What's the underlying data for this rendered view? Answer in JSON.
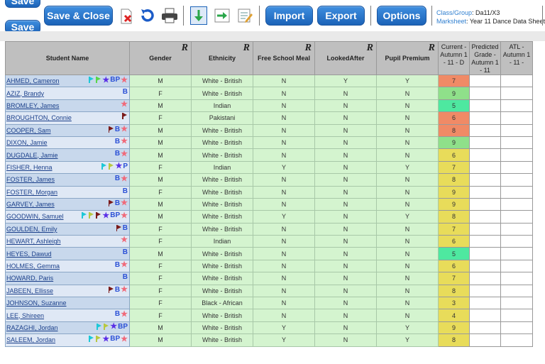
{
  "toolbar": {
    "save_label": "Save",
    "save2_label": "Save",
    "save_close_label": "Save & Close",
    "import_label": "Import",
    "export_label": "Export",
    "options_label": "Options",
    "class_group_key": "Class/Group",
    "class_group_value": ": Da11/X3",
    "marksheet_key": "Marksheet",
    "marksheet_value": ": Year 11 Dance Data Sheet"
  },
  "headers": {
    "student_name": "Student Name",
    "gender": "Gender",
    "ethnicity": "Ethnicity",
    "fsm": "Free School Meal",
    "looked_after": "LookedAfter",
    "pupil_premium": "Pupil Premium",
    "r": "R",
    "current": "Current - Autumn 1 - 11 - D",
    "predicted": "Predicted Grade - Autumn 1 - 11",
    "atl": "ATL - Autumn 1 - 11 -"
  },
  "colors": {
    "red": "#f08a66",
    "green": "#8fe08a",
    "teal": "#4ee8a0",
    "yellow": "#e8dc5a",
    "star_pink": "#f06a7a",
    "star_purple": "#5a2ee6",
    "b_blue": "#2a4fd6",
    "flag_teal": "#1ec8d8",
    "flag_green": "#5ad64a",
    "flag_maroon": "#7a1a1a",
    "flag_olive": "#b8c840"
  },
  "students": [
    {
      "name": "AHMED, Cameron",
      "gender": "M",
      "ethnicity": "White - British",
      "fsm": "N",
      "la": "Y",
      "pp": "Y",
      "current": "7",
      "cc": "red",
      "flags": [
        "flag_teal",
        "flag_green",
        "star_purple",
        "BP",
        "star_pink"
      ]
    },
    {
      "name": "AZIZ, Brandy",
      "gender": "F",
      "ethnicity": "White - British",
      "fsm": "N",
      "la": "N",
      "pp": "N",
      "current": "9",
      "cc": "green",
      "flags": [
        "B"
      ]
    },
    {
      "name": "BROMLEY, James",
      "gender": "M",
      "ethnicity": "Indian",
      "fsm": "N",
      "la": "N",
      "pp": "N",
      "current": "5",
      "cc": "teal",
      "flags": [
        "star_pink"
      ]
    },
    {
      "name": "BROUGHTON, Connie",
      "gender": "F",
      "ethnicity": "Pakistani",
      "fsm": "N",
      "la": "N",
      "pp": "N",
      "current": "6",
      "cc": "red",
      "flags": [
        "flag_maroon"
      ]
    },
    {
      "name": "COOPER, Sam",
      "gender": "M",
      "ethnicity": "White - British",
      "fsm": "N",
      "la": "N",
      "pp": "N",
      "current": "8",
      "cc": "red",
      "flags": [
        "flag_maroon",
        "B",
        "star_pink"
      ]
    },
    {
      "name": "DIXON, Jamie",
      "gender": "M",
      "ethnicity": "White - British",
      "fsm": "N",
      "la": "N",
      "pp": "N",
      "current": "9",
      "cc": "green",
      "flags": [
        "B",
        "star_pink"
      ]
    },
    {
      "name": "DUGDALE, Jamie",
      "gender": "M",
      "ethnicity": "White - British",
      "fsm": "N",
      "la": "N",
      "pp": "N",
      "current": "6",
      "cc": "yellow",
      "flags": [
        "B",
        "star_pink"
      ]
    },
    {
      "name": "FISHER, Henna",
      "gender": "F",
      "ethnicity": "Indian",
      "fsm": "Y",
      "la": "N",
      "pp": "Y",
      "current": "7",
      "cc": "yellow",
      "flags": [
        "flag_teal",
        "flag_olive",
        "star_purple",
        "P"
      ]
    },
    {
      "name": "FOSTER, James",
      "gender": "M",
      "ethnicity": "White - British",
      "fsm": "N",
      "la": "N",
      "pp": "N",
      "current": "8",
      "cc": "yellow",
      "flags": [
        "B",
        "star_pink"
      ]
    },
    {
      "name": "FOSTER, Morgan",
      "gender": "F",
      "ethnicity": "White - British",
      "fsm": "N",
      "la": "N",
      "pp": "N",
      "current": "9",
      "cc": "yellow",
      "flags": [
        "B"
      ]
    },
    {
      "name": "GARVEY, James",
      "gender": "M",
      "ethnicity": "White - British",
      "fsm": "N",
      "la": "N",
      "pp": "N",
      "current": "9",
      "cc": "yellow",
      "flags": [
        "flag_maroon",
        "B",
        "star_pink"
      ]
    },
    {
      "name": "GOODWIN, Samuel",
      "gender": "M",
      "ethnicity": "White - British",
      "fsm": "Y",
      "la": "N",
      "pp": "Y",
      "current": "8",
      "cc": "yellow",
      "flags": [
        "flag_teal",
        "flag_olive",
        "flag_maroon",
        "star_purple",
        "BP",
        "star_pink"
      ]
    },
    {
      "name": "GOULDEN, Emily",
      "gender": "F",
      "ethnicity": "White - British",
      "fsm": "N",
      "la": "N",
      "pp": "N",
      "current": "7",
      "cc": "yellow",
      "flags": [
        "flag_maroon",
        "B"
      ]
    },
    {
      "name": "HEWART, Ashleigh",
      "gender": "F",
      "ethnicity": "Indian",
      "fsm": "N",
      "la": "N",
      "pp": "N",
      "current": "6",
      "cc": "yellow",
      "flags": [
        "star_pink"
      ]
    },
    {
      "name": "HEYES, Dawud",
      "gender": "M",
      "ethnicity": "White - British",
      "fsm": "N",
      "la": "N",
      "pp": "N",
      "current": "5",
      "cc": "teal",
      "flags": [
        "B"
      ]
    },
    {
      "name": "HOLMES, Gemma",
      "gender": "F",
      "ethnicity": "White - British",
      "fsm": "N",
      "la": "N",
      "pp": "N",
      "current": "6",
      "cc": "yellow",
      "flags": [
        "B",
        "star_pink"
      ]
    },
    {
      "name": "HOWARD, Paris",
      "gender": "F",
      "ethnicity": "White - British",
      "fsm": "N",
      "la": "N",
      "pp": "N",
      "current": "7",
      "cc": "yellow",
      "flags": [
        "B"
      ]
    },
    {
      "name": "JABEEN, Ellisse",
      "gender": "F",
      "ethnicity": "White - British",
      "fsm": "N",
      "la": "N",
      "pp": "N",
      "current": "8",
      "cc": "yellow",
      "flags": [
        "flag_maroon",
        "B",
        "star_pink"
      ]
    },
    {
      "name": "JOHNSON, Suzanne",
      "gender": "F",
      "ethnicity": "Black - African",
      "fsm": "N",
      "la": "N",
      "pp": "N",
      "current": "3",
      "cc": "yellow",
      "flags": []
    },
    {
      "name": "LEE, Shireen",
      "gender": "F",
      "ethnicity": "White - British",
      "fsm": "N",
      "la": "N",
      "pp": "N",
      "current": "4",
      "cc": "yellow",
      "flags": [
        "B",
        "star_pink"
      ]
    },
    {
      "name": "RAZAGHI, Jordan",
      "gender": "M",
      "ethnicity": "White - British",
      "fsm": "Y",
      "la": "N",
      "pp": "Y",
      "current": "9",
      "cc": "yellow",
      "flags": [
        "flag_teal",
        "flag_olive",
        "star_purple",
        "BP"
      ]
    },
    {
      "name": "SALEEM, Jordan",
      "gender": "M",
      "ethnicity": "White - British",
      "fsm": "Y",
      "la": "N",
      "pp": "Y",
      "current": "8",
      "cc": "yellow",
      "flags": [
        "flag_teal",
        "flag_olive",
        "star_purple",
        "BP",
        "star_pink"
      ]
    }
  ]
}
